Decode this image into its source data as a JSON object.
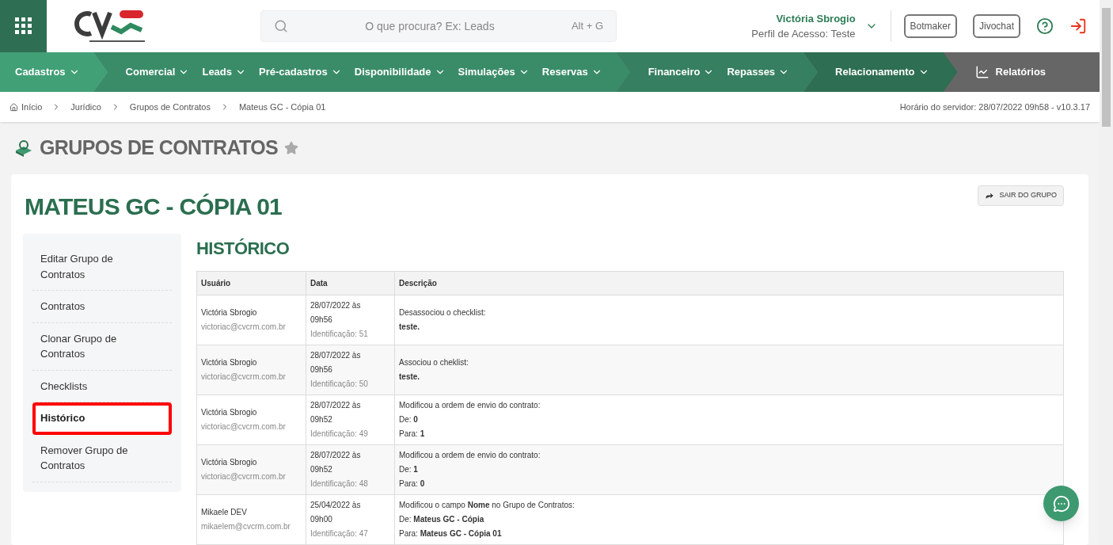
{
  "header": {
    "search": {
      "placeholder": "O que procura? Ex: Leads",
      "shortcut": "Alt + G"
    },
    "user": {
      "name": "Victória Sbrogio",
      "profile": "Perfil de Acesso: Teste"
    },
    "buttons": [
      "Botmaker",
      "Jivochat"
    ]
  },
  "nav": {
    "groups": [
      {
        "items": [
          "Cadastros"
        ]
      },
      {
        "items": [
          "Comercial",
          "Leads",
          "Pré-cadastros",
          "Disponibilidade",
          "Simulações",
          "Reservas"
        ]
      },
      {
        "items": [
          "Financeiro",
          "Repasses"
        ]
      },
      {
        "items": [
          "Relacionamento"
        ]
      }
    ],
    "reports": "Relatórios"
  },
  "breadcrumb": [
    "Início",
    "Jurídico",
    "Grupos de Contratos",
    "Mateus GC - Cópia 01"
  ],
  "server_time": "Horário do servidor: 28/07/2022 09h58 - v10.3.17",
  "page_title": "GRUPOS DE CONTRATOS",
  "record_title": "MATEUS GC - CÓPIA 01",
  "leave_button": "SAIR DO GRUPO",
  "side_menu": [
    {
      "label": "Editar Grupo de Contratos",
      "selected": false
    },
    {
      "label": "Contratos",
      "selected": false
    },
    {
      "label": "Clonar Grupo de Contratos",
      "selected": false
    },
    {
      "label": "Checklists",
      "selected": false
    },
    {
      "label": "Histórico",
      "selected": true
    },
    {
      "label": "Remover Grupo de Contratos",
      "selected": false
    }
  ],
  "section_title": "HISTÓRICO",
  "table": {
    "columns": [
      "Usuário",
      "Data",
      "Descrição"
    ],
    "rows": [
      {
        "user": "Victória Sbrogio",
        "email": "victoriac@cvcrm.com.br",
        "date": "28/07/2022 às 09h56",
        "id": "Identificação: 51",
        "description": [
          "Desassociou o checklist:",
          "**teste.**"
        ]
      },
      {
        "user": "Victória Sbrogio",
        "email": "victoriac@cvcrm.com.br",
        "date": "28/07/2022 às 09h56",
        "id": "Identificação: 50",
        "description": [
          "Associou o cheklist:",
          "**teste.**"
        ]
      },
      {
        "user": "Victória Sbrogio",
        "email": "victoriac@cvcrm.com.br",
        "date": "28/07/2022 às 09h52",
        "id": "Identificação: 49",
        "description": [
          "Modificou a ordem de envio do contrato:",
          "De: **0**",
          "Para: **1**"
        ]
      },
      {
        "user": "Victória Sbrogio",
        "email": "victoriac@cvcrm.com.br",
        "date": "28/07/2022 às 09h52",
        "id": "Identificação: 48",
        "description": [
          "Modificou a ordem de envio do contrato:",
          "De: **1**",
          "Para: **0**"
        ]
      },
      {
        "user": "Mikaele DEV",
        "email": "mikaelem@cvcrm.com.br",
        "date": "25/04/2022 às 09h00",
        "id": "Identificação: 47",
        "description": [
          "Modificou o campo **Nome** no Grupo de Contratos:",
          "De: **Mateus GC - Cópia**",
          "Para: **Mateus GC - Cópia 01**"
        ]
      }
    ]
  }
}
